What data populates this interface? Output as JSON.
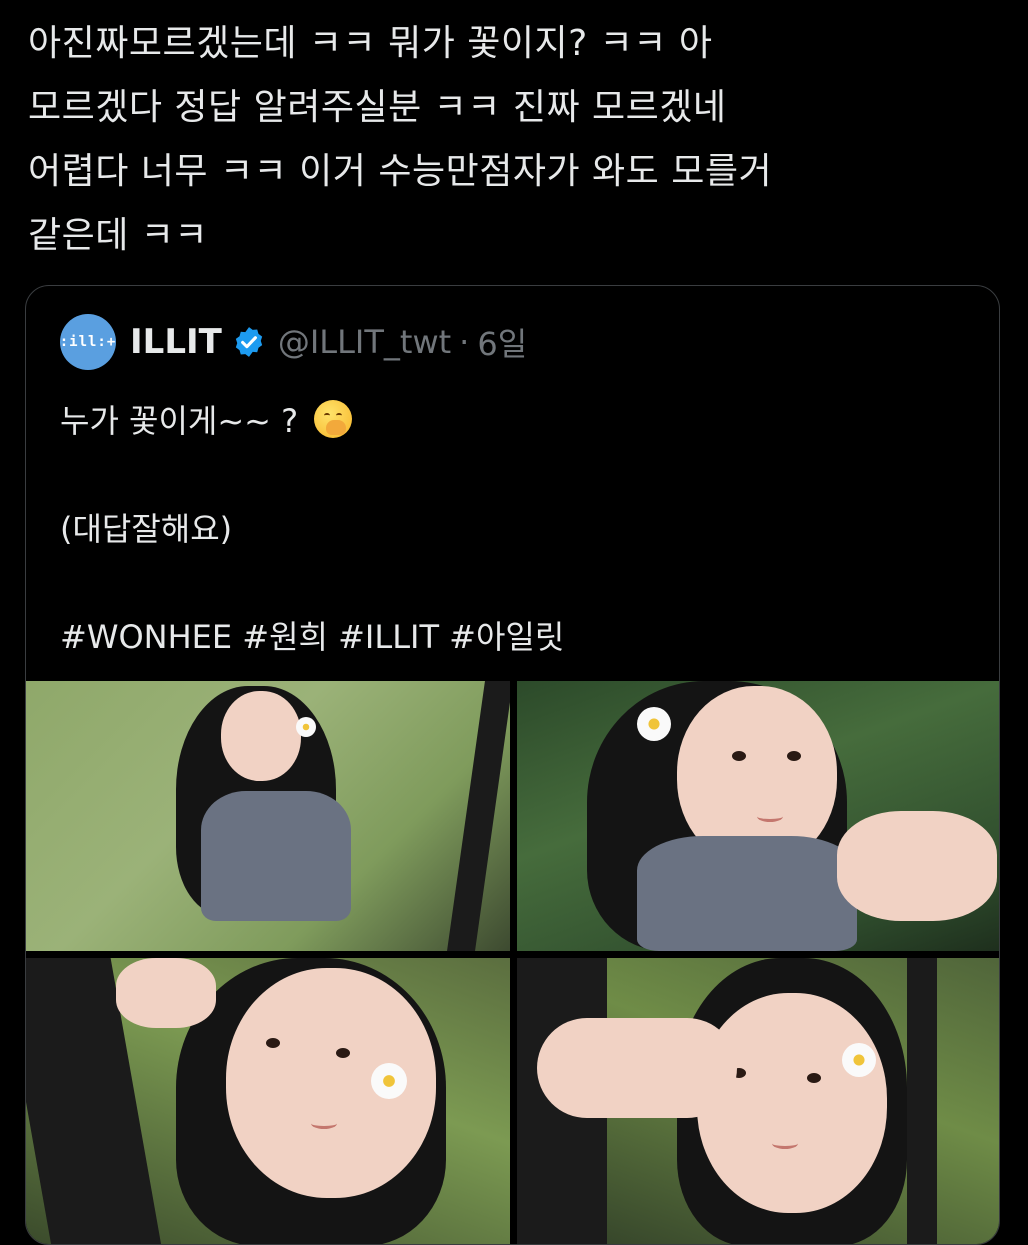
{
  "post": {
    "text": "아진짜모르겠는데 ㅋㅋ 뭐가 꽃이지? ㅋㅋ 아\n모르겠다 정답 알려주실분 ㅋㅋ 진짜 모르겠네\n어렵다 너무 ㅋㅋ 이거 수능만점자가 와도 모를거\n같은데 ㅋㅋ"
  },
  "quote": {
    "avatar_text": ":ill:+",
    "name": "ILLIT",
    "verified_icon": "verified-badge-icon",
    "handle": "@ILLIT_twt",
    "separator": "·",
    "time": "6일",
    "line1": "누가 꽃이게~~ ?",
    "line1_emoji": "face-with-hand-over-mouth-emoji",
    "line2": "(대답잘해요)",
    "line3": "#WONHEE #원희 #ILLIT #아일릿",
    "photos": [
      "photo-1",
      "photo-2",
      "photo-3",
      "photo-4"
    ]
  },
  "colors": {
    "background": "#000000",
    "text": "#e7e9ea",
    "muted": "#71767b",
    "verified": "#1d9bf0",
    "avatar": "#5a9fe0"
  }
}
